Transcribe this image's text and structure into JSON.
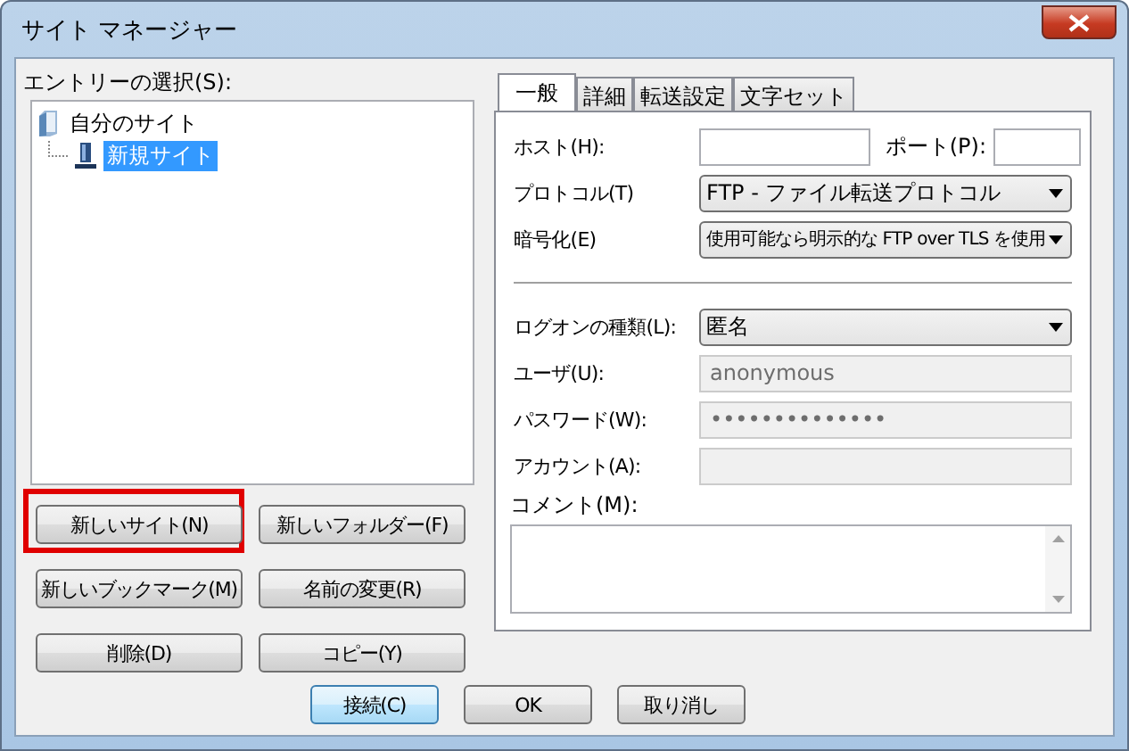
{
  "window": {
    "title": "サイト マネージャー"
  },
  "entry_label": "エントリーの選択(S):",
  "tree": [
    {
      "label": "自分のサイト",
      "kind": "folder",
      "selected": false,
      "children": [
        {
          "label": "新規サイト",
          "kind": "site",
          "selected": true
        }
      ]
    }
  ],
  "site_buttons": [
    {
      "label": "新しいサイト(N)",
      "highlighted": true
    },
    {
      "label": "新しいフォルダー(F)",
      "highlighted": false
    },
    {
      "label": "新しいブックマーク(M)",
      "highlighted": false
    },
    {
      "label": "名前の変更(R)",
      "highlighted": false
    },
    {
      "label": "削除(D)",
      "highlighted": false
    },
    {
      "label": "コピー(Y)",
      "highlighted": false
    }
  ],
  "tabs": [
    {
      "label": "一般",
      "selected": true
    },
    {
      "label": "詳細",
      "selected": false
    },
    {
      "label": "転送設定",
      "selected": false
    },
    {
      "label": "文字セット",
      "selected": false
    }
  ],
  "host_row": {
    "host_label": "ホスト(H):",
    "port_label": "ポート(P):"
  },
  "connection_fields": [
    {
      "kind": "dropdown",
      "label": "プロトコル(T)",
      "value": "FTP - ファイル転送プロトコル"
    },
    {
      "kind": "dropdown",
      "label": "暗号化(E)",
      "value": "使用可能なら明示的な FTP over TLS を使用"
    }
  ],
  "logon_fields": [
    {
      "kind": "dropdown",
      "label": "ログオンの種類(L):",
      "value": "匿名",
      "disabled": false
    },
    {
      "kind": "text",
      "label": "ユーザ(U):",
      "value": "anonymous",
      "disabled": true
    },
    {
      "kind": "text",
      "label": "パスワード(W):",
      "value": "••••••••••••••",
      "disabled": true
    },
    {
      "kind": "text",
      "label": "アカウント(A):",
      "disabled": true
    }
  ],
  "comment": {
    "label": "コメント(M):"
  },
  "dialog_buttons": [
    {
      "label": "接続(C)",
      "default": true
    },
    {
      "label": "OK",
      "default": false
    },
    {
      "label": "取り消し",
      "default": false
    }
  ]
}
